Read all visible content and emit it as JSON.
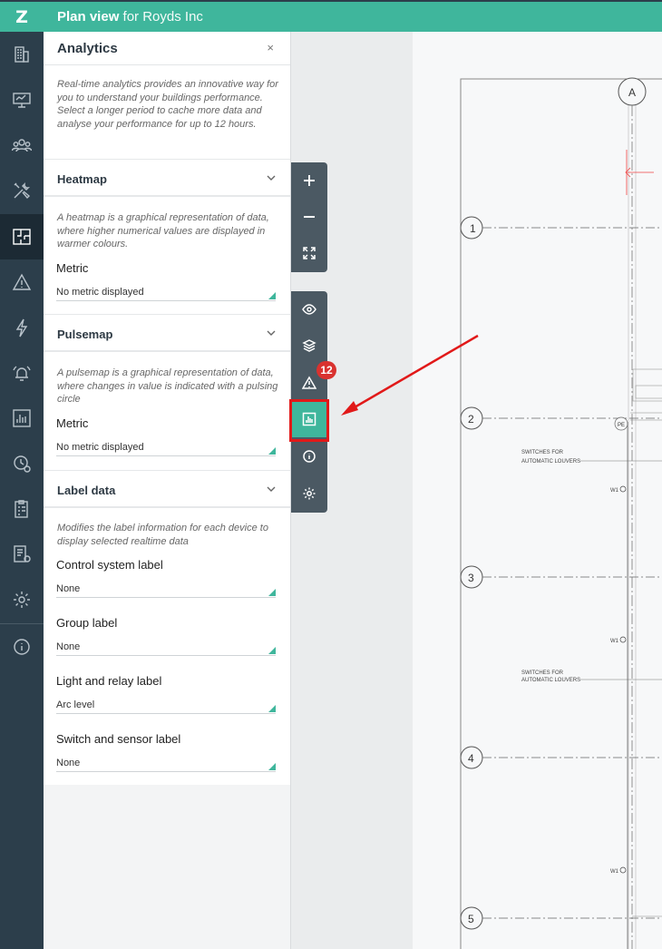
{
  "app": {
    "logo": "Z",
    "title_bold": "Plan view",
    "title_rest": " for Royds Inc"
  },
  "nav": {
    "items": [
      "building-icon",
      "dashboard-icon",
      "people-icon",
      "tools-icon",
      "floorplan-icon",
      "warning-icon",
      "energy-icon",
      "alarm-icon",
      "reports-icon",
      "schedule-icon",
      "checklist-icon",
      "devices-icon",
      "settings-icon",
      "info-icon"
    ],
    "active": "floorplan-icon"
  },
  "panel": {
    "title": "Analytics",
    "close": "×",
    "intro": "Real-time analytics provides an innovative way for you to understand your buildings performance. Select a longer period to cache more data and analyse your performance for up to 12 hours.",
    "heatmap": {
      "title": "Heatmap",
      "desc": "A heatmap is a graphical representation of data, where higher numerical values are displayed in warmer colours.",
      "metric_label": "Metric",
      "metric_value": "No metric displayed"
    },
    "pulsemap": {
      "title": "Pulsemap",
      "desc": "A pulsemap is a graphical representation of data, where changes in value is indicated with a pulsing circle",
      "metric_label": "Metric",
      "metric_value": "No metric displayed"
    },
    "label_data": {
      "title": "Label data",
      "desc": "Modifies the label information for each device to display selected realtime data",
      "control_label": "Control system label",
      "control_value": "None",
      "group_label": "Group label",
      "group_value": "None",
      "light_label": "Light and relay label",
      "light_value": "Arc level",
      "switch_label": "Switch and sensor label",
      "switch_value": "None"
    }
  },
  "toolbar": {
    "alerts_badge": "12"
  },
  "drawing": {
    "grid_col": "A",
    "grid_rows": [
      "1",
      "2",
      "3",
      "4",
      "5"
    ],
    "note": "SWITCHES FOR",
    "note2": "AUTOMATIC LOUVERS",
    "pe": "PE",
    "w": "W1"
  },
  "colors": {
    "accent": "#3fb69c",
    "nav_bg": "#2c3e4b",
    "alert": "#d9322f",
    "annotation": "#e11919"
  }
}
